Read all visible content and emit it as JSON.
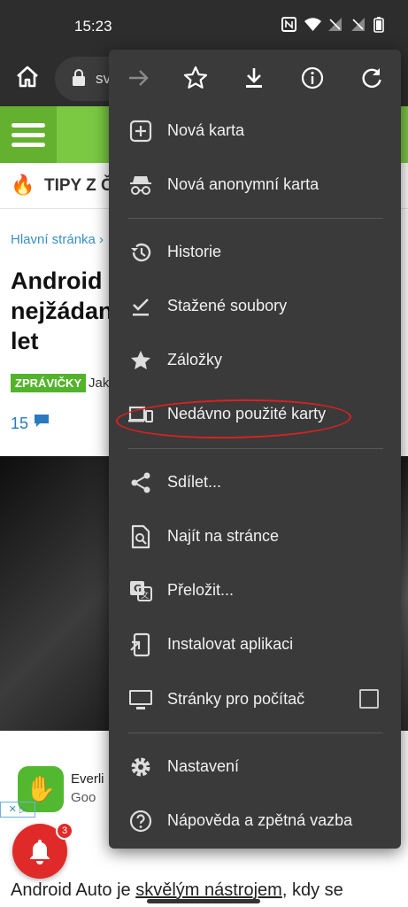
{
  "status": {
    "time": "15:23"
  },
  "browser": {
    "url_partial": "sv"
  },
  "page": {
    "tips_text": "TIPY Z Č",
    "breadcrumb": "Hlavní stránka ›",
    "title_lines": [
      "Android",
      "nejžádan",
      "let"
    ],
    "badge": "ZPRÁVIČKY",
    "author_partial": "Jak",
    "comment_count": "15",
    "ad_title": "Everli",
    "ad_sub": "Goo",
    "notification_count": "3",
    "body_text_prefix": "Android Auto je ",
    "body_text_link": "skvělým nástrojem",
    "body_text_suffix": ", kdy se"
  },
  "menu": {
    "toolbar": [
      "forward-icon",
      "star-icon",
      "download-icon",
      "info-icon",
      "refresh-icon"
    ],
    "items": [
      {
        "label": "Nová karta",
        "icon": "plus-box-icon"
      },
      {
        "label": "Nová anonymní karta",
        "icon": "incognito-icon"
      },
      {
        "label": "Historie",
        "icon": "history-icon"
      },
      {
        "label": "Stažené soubory",
        "icon": "check-download-icon"
      },
      {
        "label": "Záložky",
        "icon": "star-icon"
      },
      {
        "label": "Nedávno použité karty",
        "icon": "devices-icon"
      },
      {
        "label": "Sdílet...",
        "icon": "share-icon"
      },
      {
        "label": "Najít na stránce",
        "icon": "find-in-page-icon"
      },
      {
        "label": "Přeložit...",
        "icon": "translate-icon"
      },
      {
        "label": "Instalovat aplikaci",
        "icon": "install-app-icon"
      },
      {
        "label": "Stránky pro počítač",
        "icon": "desktop-icon",
        "checkbox": false
      },
      {
        "label": "Nastavení",
        "icon": "gear-icon"
      },
      {
        "label": "Nápověda a zpětná vazba",
        "icon": "help-icon"
      }
    ]
  },
  "colors": {
    "brand_green": "#7bc943",
    "menu_bg": "#3a3a3a",
    "highlight": "#d92121",
    "notification_red": "#e02a2a"
  }
}
